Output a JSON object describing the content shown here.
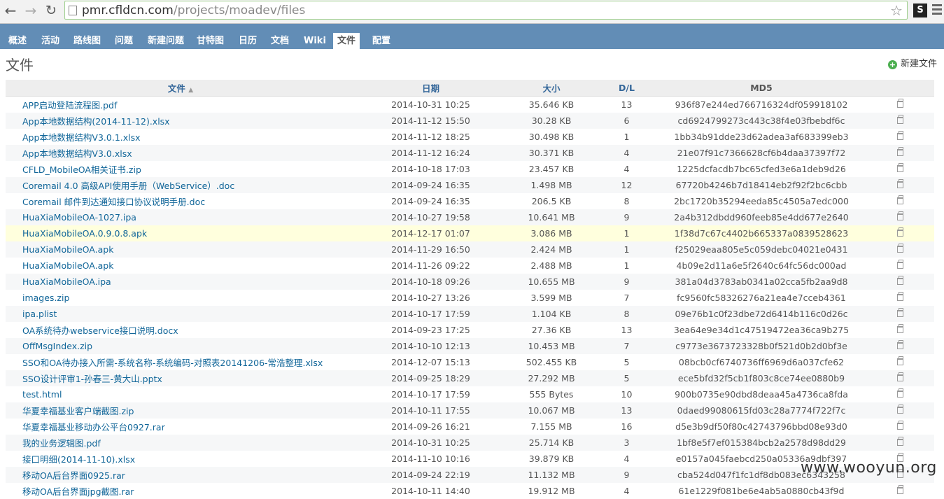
{
  "browser": {
    "url_host": "pmr.cfldcn.com",
    "url_path": "/projects/moadev/files",
    "ext_label": "S"
  },
  "tabs": [
    {
      "label": "概述"
    },
    {
      "label": "活动"
    },
    {
      "label": "路线图"
    },
    {
      "label": "问题"
    },
    {
      "label": "新建问题"
    },
    {
      "label": "甘特图"
    },
    {
      "label": "日历"
    },
    {
      "label": "文档"
    },
    {
      "label": "Wiki"
    },
    {
      "label": "文件",
      "selected": true
    },
    {
      "label": "配置"
    }
  ],
  "page": {
    "title": "文件",
    "new_file_label": "新建文件"
  },
  "table": {
    "headers": {
      "file": "文件",
      "sort_indicator": "▲",
      "date": "日期",
      "size": "大小",
      "dl": "D/L",
      "md5": "MD5"
    },
    "rows": [
      {
        "name": "APP启动登陆流程图.pdf",
        "date": "2014-10-31 10:25",
        "size": "35.646 KB",
        "dl": "13",
        "md5": "936f87e244ed766716324df059918102"
      },
      {
        "name": "App本地数据结构(2014-11-12).xlsx",
        "date": "2014-11-12 15:50",
        "size": "30.28 KB",
        "dl": "6",
        "md5": "cd6924799273c443c38f4e03fbebdf6c"
      },
      {
        "name": "App本地数据结构V3.0.1.xlsx",
        "date": "2014-11-12 18:25",
        "size": "30.498 KB",
        "dl": "1",
        "md5": "1bb34b91dde23d62adea3af683399eb3"
      },
      {
        "name": "App本地数据结构V3.0.xlsx",
        "date": "2014-11-12 16:24",
        "size": "30.371 KB",
        "dl": "4",
        "md5": "21e07f91c7366628cf6b4daa37397f72"
      },
      {
        "name": "CFLD_MobileOA相关证书.zip",
        "date": "2014-10-18 17:03",
        "size": "23.457 KB",
        "dl": "4",
        "md5": "1225dcfacdb7bc65cfed3e6a1deb9d26"
      },
      {
        "name": "Coremail 4.0 高级API使用手册（WebService）.doc",
        "date": "2014-09-24 16:35",
        "size": "1.498 MB",
        "dl": "12",
        "md5": "67720b4246b7d18414eb2f92f2bc6cbb"
      },
      {
        "name": "Coremail 邮件到达通知接口协议说明手册.doc",
        "date": "2014-09-24 16:35",
        "size": "206.5 KB",
        "dl": "8",
        "md5": "2bc1720b35294eeda85c4505a7edc000"
      },
      {
        "name": "HuaXiaMobileOA-1027.ipa",
        "date": "2014-10-27 19:58",
        "size": "10.641 MB",
        "dl": "9",
        "md5": "2a4b312dbdd960feeb85e4dd677e2640"
      },
      {
        "name": "HuaXiaMobileOA.0.9.0.8.apk",
        "date": "2014-12-17 01:07",
        "size": "3.086 MB",
        "dl": "1",
        "md5": "1f38d7c67c4402b665337a0839528623",
        "highlight": true
      },
      {
        "name": "HuaXiaMobileOA.apk",
        "date": "2014-11-29 16:50",
        "size": "2.424 MB",
        "dl": "1",
        "md5": "f25029eaa805e5c059debc04021e0431"
      },
      {
        "name": "HuaXiaMobileOA.apk",
        "date": "2014-11-26 09:22",
        "size": "2.488 MB",
        "dl": "1",
        "md5": "4b09e2d11a6e5f2640c64fc56dc000ad"
      },
      {
        "name": "HuaXiaMobileOA.ipa",
        "date": "2014-10-18 09:26",
        "size": "10.655 MB",
        "dl": "9",
        "md5": "381a04d3783ab0341a02cca5fb2aa9d8"
      },
      {
        "name": "images.zip",
        "date": "2014-10-27 13:26",
        "size": "3.599 MB",
        "dl": "7",
        "md5": "fc9560fc58326276a21ea4e7cceb4361"
      },
      {
        "name": "ipa.plist",
        "date": "2014-10-17 17:59",
        "size": "1.104 KB",
        "dl": "8",
        "md5": "09e76b1c0f23dbe72d6414b116c0d26c"
      },
      {
        "name": "OA系统待办webservice接口说明.docx",
        "date": "2014-09-23 17:25",
        "size": "27.36 KB",
        "dl": "13",
        "md5": "3ea64e9e34d1c47519472ea36ca9b275"
      },
      {
        "name": "OffMsgIndex.zip",
        "date": "2014-10-10 12:13",
        "size": "10.453 MB",
        "dl": "7",
        "md5": "c9773e3673723328b0f521d0b2d0bf3e"
      },
      {
        "name": "SSO和OA待办接入所需-系统名称-系统编码-对照表20141206-常浩整理.xlsx",
        "date": "2014-12-07 15:13",
        "size": "502.455 KB",
        "dl": "5",
        "md5": "08bcb0cf6740736ff6969d6a037cfe62"
      },
      {
        "name": "SSO设计评审1-孙春三-黄大山.pptx",
        "date": "2014-09-25 18:29",
        "size": "27.292 MB",
        "dl": "5",
        "md5": "ece5bfd32f5cb1f803c8ce74ee0880b9"
      },
      {
        "name": "test.html",
        "date": "2014-10-17 17:59",
        "size": "555 Bytes",
        "dl": "10",
        "md5": "900b0735e90dbd8deaa45a4736ca8fda"
      },
      {
        "name": "华夏幸福基业客户端截图.zip",
        "date": "2014-10-11 17:55",
        "size": "10.067 MB",
        "dl": "13",
        "md5": "0daed99080615fd03c28a7774f722f7c"
      },
      {
        "name": "华夏幸福基业移动办公平台0927.rar",
        "date": "2014-09-26 16:21",
        "size": "7.155 MB",
        "dl": "16",
        "md5": "d5e3b9df50f80c42743796bbd08e93d0"
      },
      {
        "name": "我的业务逻辑图.pdf",
        "date": "2014-10-31 10:25",
        "size": "25.714 KB",
        "dl": "3",
        "md5": "1bf8e5f7ef015384bcb2a2578d98dd29"
      },
      {
        "name": "接口明细(2014-11-10).xlsx",
        "date": "2014-11-10 10:16",
        "size": "39.879 KB",
        "dl": "4",
        "md5": "e0157a045faebcd250a05336a9dbf397"
      },
      {
        "name": "移动OA后台界面0925.rar",
        "date": "2014-09-24 22:19",
        "size": "11.132 MB",
        "dl": "9",
        "md5": "cba524d047f1fc1df8db083ec6343258"
      },
      {
        "name": "移动OA后台界面jpg截图.rar",
        "date": "2014-10-11 14:40",
        "size": "19.912 MB",
        "dl": "4",
        "md5": "61e1229f081be6e4ab5a0880cb43f9d"
      }
    ]
  },
  "watermark": "www.wooyun.org"
}
